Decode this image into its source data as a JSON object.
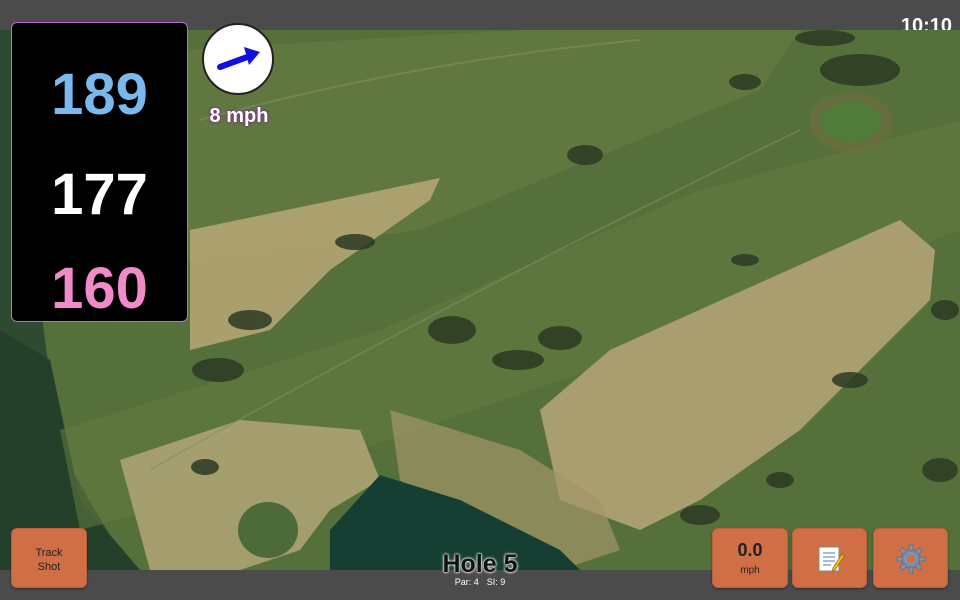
{
  "status_bar": {
    "time": "10:10"
  },
  "distances": {
    "back": "189",
    "middle": "177",
    "front": "160"
  },
  "wind": {
    "speed": "8 mph",
    "icon": "arrow-icon",
    "arrow_color": "#1010e0"
  },
  "colors": {
    "back_distance": "#7ab9ee",
    "middle_distance": "#ffffff",
    "front_distance": "#f08ac8",
    "button_bg": "#d06f45",
    "panel_border": "#c06bd0"
  },
  "buttons": {
    "track_shot_line1": "Track",
    "track_shot_line2": "Shot",
    "speed_value": "0.0",
    "speed_unit": "mph",
    "notes_icon": "notepad-icon",
    "settings_icon": "gear-icon"
  },
  "hole": {
    "title": "Hole 5",
    "par": "Par: 4",
    "si": "SI: 9"
  },
  "map": {
    "type": "satellite-aerial-golf-course"
  }
}
